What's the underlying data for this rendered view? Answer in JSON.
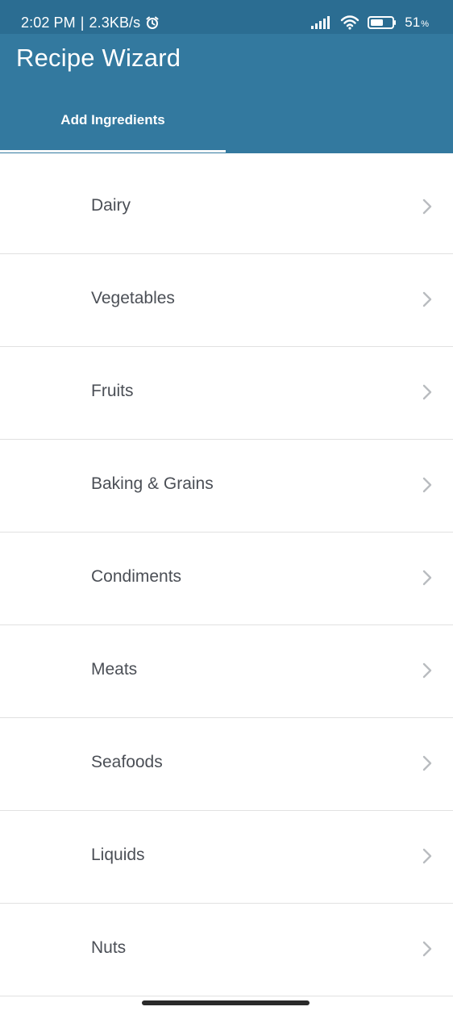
{
  "status_bar": {
    "time": "2:02 PM",
    "separator": "|",
    "speed": "2.3KB/s",
    "battery_level": "51",
    "battery_unit": "%"
  },
  "app_bar": {
    "title": "Recipe Wizard"
  },
  "tabs": [
    {
      "label": "Add Ingredients",
      "selected": true
    }
  ],
  "categories": [
    {
      "label": "Dairy"
    },
    {
      "label": "Vegetables"
    },
    {
      "label": "Fruits"
    },
    {
      "label": "Baking & Grains"
    },
    {
      "label": "Condiments"
    },
    {
      "label": "Meats"
    },
    {
      "label": "Seafoods"
    },
    {
      "label": "Liquids"
    },
    {
      "label": "Nuts"
    }
  ],
  "colors": {
    "header": "#33799f",
    "status_bar": "#2b6d92",
    "text_primary": "#4b4f56",
    "chevron": "#b9bcc0",
    "divider": "#e1e1e1"
  },
  "icons": {
    "alarm": "alarm-clock-icon",
    "signal": "cellular-signal-icon",
    "wifi": "wifi-icon",
    "battery": "battery-icon",
    "list_item": "chevron-right-icon"
  }
}
